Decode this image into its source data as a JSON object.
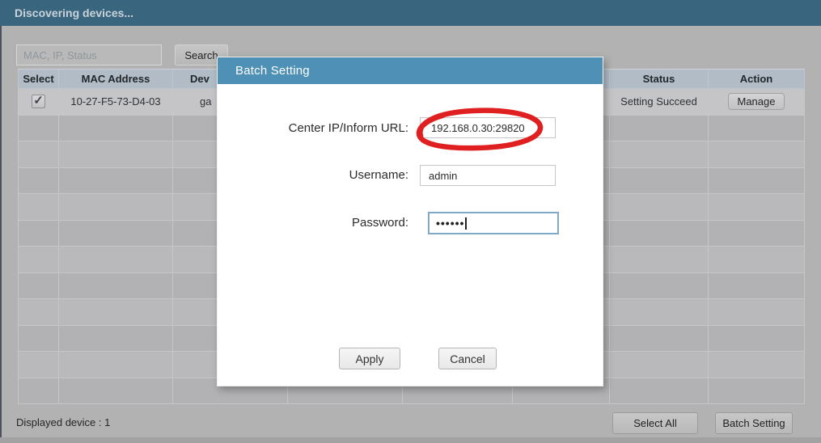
{
  "window": {
    "title": "Discovering devices..."
  },
  "search": {
    "placeholder": "MAC, IP, Status",
    "button_label": "Search"
  },
  "table": {
    "columns": [
      "Select",
      "MAC Address",
      "Dev",
      "",
      "",
      "",
      "Status",
      "Action"
    ],
    "row": {
      "selected": true,
      "mac_address": "10-27-F5-73-D4-03",
      "device_name_visible": "ga",
      "status": "Setting Succeed",
      "action_label": "Manage"
    },
    "empty_row_count": 11
  },
  "modal": {
    "title": "Batch Setting",
    "fields": [
      {
        "label": "Center IP/Inform URL:",
        "value": "192.168.0.30:29820"
      },
      {
        "label": "Username:",
        "value": "admin"
      },
      {
        "label": "Password:",
        "value": "••••••"
      }
    ],
    "apply_label": "Apply",
    "cancel_label": "Cancel",
    "annotation_color": "#e02020"
  },
  "footer": {
    "displayed_text": "Displayed device : 1",
    "select_all_label": "Select All",
    "batch_setting_label": "Batch Setting"
  },
  "icons": {
    "check": "✓"
  },
  "colors": {
    "titlebar": "#3a657f",
    "modal_titlebar": "#4e90b6",
    "page_background": "#b2b2b2",
    "table_header_background": "#b1bcc6",
    "row_selected_background": "#c5c5c7",
    "annotation_red": "#e02020"
  }
}
